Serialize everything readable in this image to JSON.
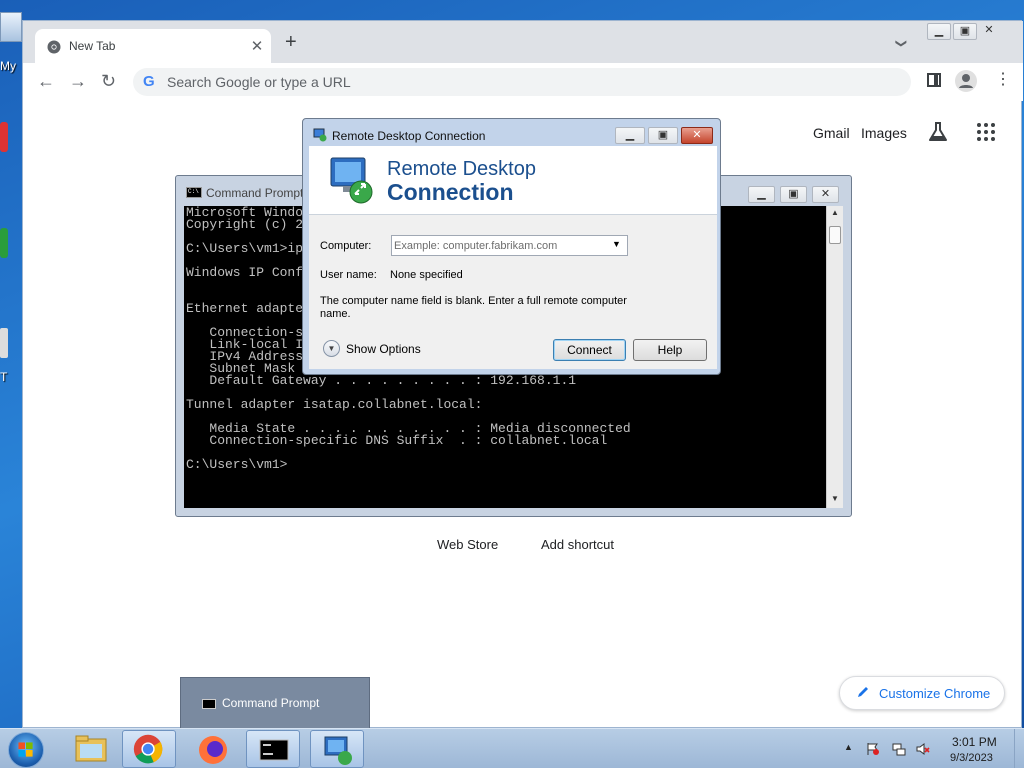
{
  "desktop": {
    "icon_labels": [
      "My",
      "T"
    ]
  },
  "chrome": {
    "tab_title": "New Tab",
    "tab_close": "✕",
    "new_tab": "+",
    "tabs_menu": "❯",
    "omnibox_placeholder": "Search Google or type a URL",
    "links": {
      "gmail": "Gmail",
      "images": "Images"
    },
    "shortcuts": {
      "web_store": "Web Store",
      "add_shortcut": "Add shortcut"
    },
    "customize_label": "Customize Chrome",
    "accent_color": "#1a73e8"
  },
  "cmd": {
    "title": "Command Prompt",
    "output_lines": [
      "Microsoft Windo",
      "Copyright (c) 2",
      "",
      "C:\\Users\\vm1>ip",
      "",
      "Windows IP Conf",
      "",
      "",
      "Ethernet adapte",
      "",
      "   Connection-s",
      "   Link-local I",
      "   IPv4 Address",
      "   Subnet Mask ",
      "   Default Gateway . . . . . . . . . : 192.168.1.1",
      "",
      "Tunnel adapter isatap.collabnet.local:",
      "",
      "   Media State . . . . . . . . . . . : Media disconnected",
      "   Connection-specific DNS Suffix  . : collabnet.local",
      "",
      "C:\\Users\\vm1>"
    ]
  },
  "rdc": {
    "title": "Remote Desktop Connection",
    "banner_line1": "Remote Desktop",
    "banner_line2": "Connection",
    "computer_label": "Computer:",
    "computer_placeholder": "Example: computer.fabrikam.com",
    "username_label": "User name:",
    "username_value": "None specified",
    "message": "The computer name field is blank. Enter a full remote computer name.",
    "show_options": "Show Options",
    "connect": "Connect",
    "help": "Help"
  },
  "taskbar": {
    "popup_label": "Command Prompt",
    "clock_time": "3:01 PM",
    "clock_date": "9/3/2023"
  }
}
